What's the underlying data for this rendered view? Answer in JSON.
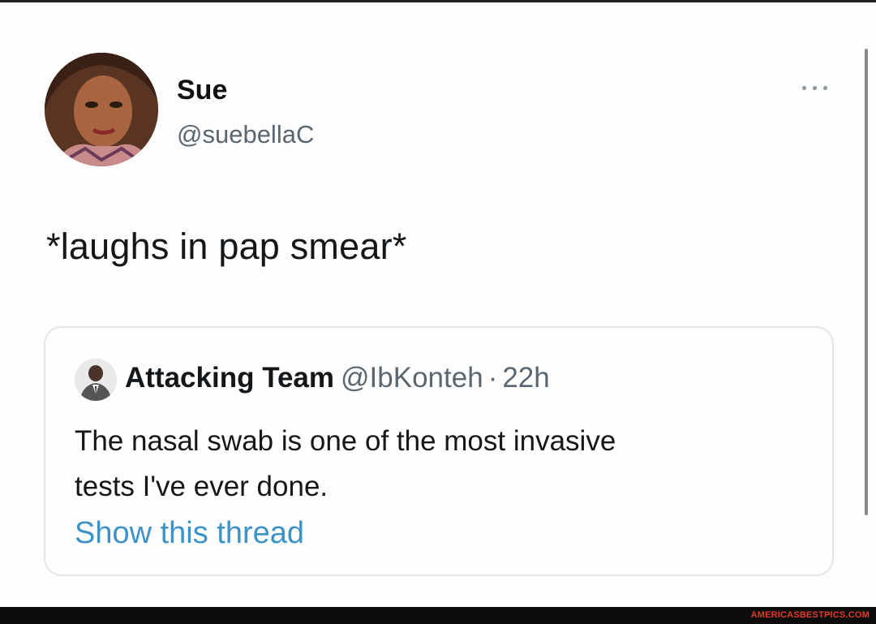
{
  "tweet": {
    "author_name": "Sue",
    "author_handle": "@suebellaC",
    "avatar_icon": "user-avatar-photo",
    "more_icon": "more-options-icon",
    "text": "*laughs in pap smear*"
  },
  "quoted_tweet": {
    "author_name": "Attacking Team",
    "author_handle": "@IbKonteh",
    "separator": "·",
    "time": "22h",
    "avatar_icon": "user-avatar-photo",
    "text_lines": [
      "The nasal swab is one of the most invasive",
      "tests I've ever done."
    ],
    "show_thread_label": "Show this thread"
  },
  "watermark": "AMERICASBESTPICS.COM",
  "colors": {
    "link": "#3d93c6",
    "secondary_text": "#5b6670",
    "primary_text": "#14171a",
    "card_border": "#e1e8ed",
    "watermark": "#e23a2a"
  }
}
